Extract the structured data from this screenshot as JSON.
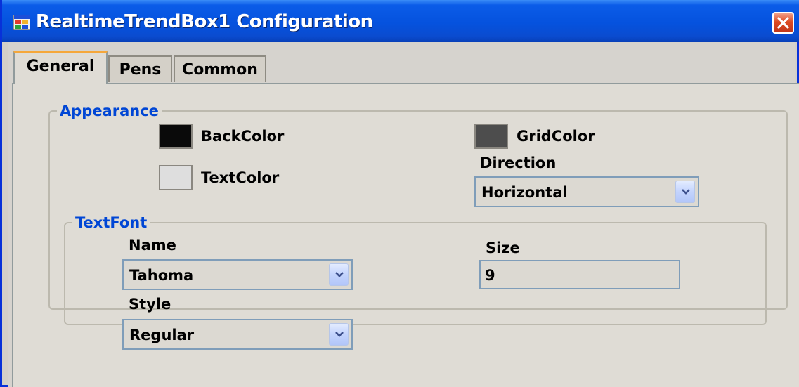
{
  "window": {
    "title": "RealtimeTrendBox1 Configuration",
    "icon": "app-window-icon",
    "close_icon": "close-icon"
  },
  "tabs": [
    {
      "label": "General",
      "active": true
    },
    {
      "label": "Pens",
      "active": false
    },
    {
      "label": "Common",
      "active": false
    }
  ],
  "appearance": {
    "legend": "Appearance",
    "back_color": {
      "label": "BackColor",
      "color": "#0a0a0a"
    },
    "text_color": {
      "label": "TextColor",
      "color": "#dedede"
    },
    "grid_color": {
      "label": "GridColor",
      "color": "#4d4d4d"
    },
    "direction": {
      "label": "Direction",
      "value": "Horizontal"
    }
  },
  "text_font": {
    "legend": "TextFont",
    "name": {
      "label": "Name",
      "value": "Tahoma"
    },
    "style": {
      "label": "Style",
      "value": "Regular"
    },
    "size": {
      "label": "Size",
      "value": "9"
    }
  },
  "colors": {
    "title_bar": "#0552de",
    "dialog_bg": "#d4d0c8",
    "group_legend": "#0046d5",
    "combo_border": "#7f9db9",
    "active_tab_accent": "#f5a73a"
  }
}
